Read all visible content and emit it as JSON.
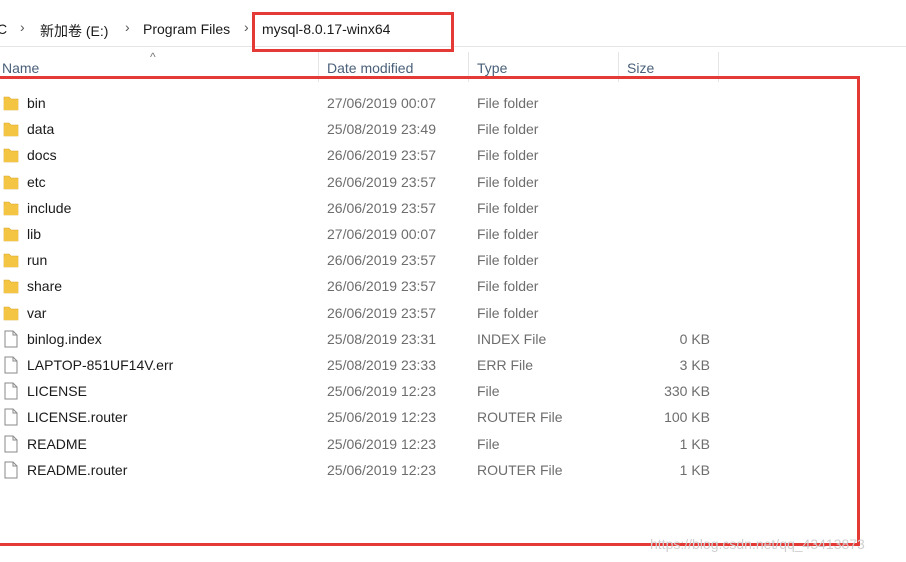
{
  "breadcrumb": {
    "items": [
      "C",
      "新加卷 (E:)",
      "Program Files",
      "mysql-8.0.17-winx64"
    ]
  },
  "columns": {
    "name": "Name",
    "date": "Date modified",
    "type": "Type",
    "size": "Size"
  },
  "files": [
    {
      "name": "bin",
      "date": "27/06/2019 00:07",
      "type": "File folder",
      "size": "",
      "kind": "folder-icon"
    },
    {
      "name": "data",
      "date": "25/08/2019 23:49",
      "type": "File folder",
      "size": "",
      "kind": "folder-icon"
    },
    {
      "name": "docs",
      "date": "26/06/2019 23:57",
      "type": "File folder",
      "size": "",
      "kind": "folder-icon"
    },
    {
      "name": "etc",
      "date": "26/06/2019 23:57",
      "type": "File folder",
      "size": "",
      "kind": "folder-icon"
    },
    {
      "name": "include",
      "date": "26/06/2019 23:57",
      "type": "File folder",
      "size": "",
      "kind": "folder-icon"
    },
    {
      "name": "lib",
      "date": "27/06/2019 00:07",
      "type": "File folder",
      "size": "",
      "kind": "folder-icon"
    },
    {
      "name": "run",
      "date": "26/06/2019 23:57",
      "type": "File folder",
      "size": "",
      "kind": "folder-icon"
    },
    {
      "name": "share",
      "date": "26/06/2019 23:57",
      "type": "File folder",
      "size": "",
      "kind": "folder-icon"
    },
    {
      "name": "var",
      "date": "26/06/2019 23:57",
      "type": "File folder",
      "size": "",
      "kind": "folder-icon"
    },
    {
      "name": "binlog.index",
      "date": "25/08/2019 23:31",
      "type": "INDEX File",
      "size": "0 KB",
      "kind": "file-icon"
    },
    {
      "name": "LAPTOP-851UF14V.err",
      "date": "25/08/2019 23:33",
      "type": "ERR File",
      "size": "3 KB",
      "kind": "file-icon"
    },
    {
      "name": "LICENSE",
      "date": "25/06/2019 12:23",
      "type": "File",
      "size": "330 KB",
      "kind": "file-icon"
    },
    {
      "name": "LICENSE.router",
      "date": "25/06/2019 12:23",
      "type": "ROUTER File",
      "size": "100 KB",
      "kind": "file-icon"
    },
    {
      "name": "README",
      "date": "25/06/2019 12:23",
      "type": "File",
      "size": "1 KB",
      "kind": "file-icon"
    },
    {
      "name": "README.router",
      "date": "25/06/2019 12:23",
      "type": "ROUTER File",
      "size": "1 KB",
      "kind": "file-icon"
    }
  ],
  "watermark": "https://blog.csdn.net/qq_43413873",
  "colors": {
    "annotation": "#e53935",
    "folder": "#f4c542",
    "header_text": "#4a607a"
  }
}
